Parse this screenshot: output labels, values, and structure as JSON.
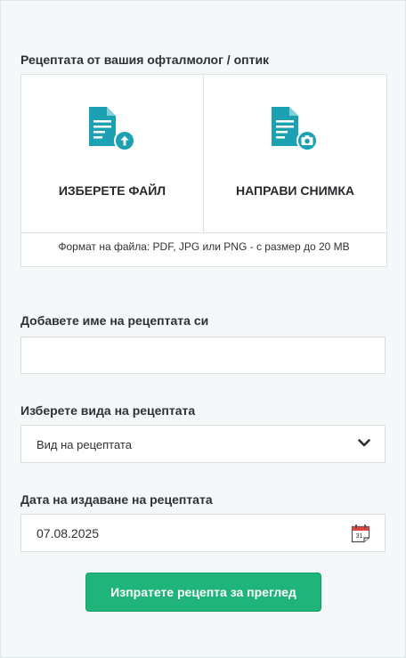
{
  "prescription_section": {
    "title": "Рецептата от вашия офталмолог / оптик",
    "choose_file_label": "ИЗБЕРЕТЕ ФАЙЛ",
    "take_photo_label": "НАПРАВИ СНИМКА",
    "format_note": "Формат на файла: PDF, JPG или PNG - с размер до 20 MB"
  },
  "name_field": {
    "label": "Добавете име на рецептата си",
    "value": "",
    "placeholder": ""
  },
  "type_field": {
    "label": "Изберете вида на рецептата",
    "selected": "Вид на рецептата"
  },
  "date_field": {
    "label": "Дата на издаване на рецептата",
    "value": "07.08.2025",
    "calendar_day": "31"
  },
  "submit_label": "Изпратете рецепта за преглед",
  "colors": {
    "icon_teal": "#1ca1b3",
    "button_green": "#1fb57a",
    "panel_bg": "#f4f8f8"
  },
  "icons": {
    "upload": "document-upload-icon",
    "photo": "document-camera-icon",
    "dropdown": "chevron-down-icon",
    "calendar": "calendar-icon"
  }
}
